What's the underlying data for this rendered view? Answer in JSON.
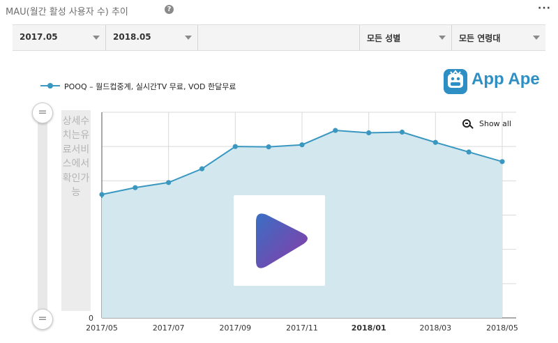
{
  "header": {
    "title": "MAU(월간 활성 사용자 수) 추이",
    "help_icon": "question-circle-icon",
    "more_icon": "more-horizontal-icon"
  },
  "filters": [
    {
      "label": "2017.05"
    },
    {
      "label": "2018.05"
    },
    {
      "label": "모든 성별"
    },
    {
      "label": "모든 연령대"
    }
  ],
  "legend": {
    "label": "POOQ – 월드컵중계, 실시간TV 무료, VOD 한달무료"
  },
  "logo": {
    "text": "App Ape"
  },
  "paywall_text": "상세수치는유료서비스에서확인가능",
  "show_all_label": "Show all",
  "colors": {
    "line": "#3a97c0",
    "area": "#d3e7ee",
    "grid": "#d9d9d9",
    "play_gradient_start": "#3a6fc4",
    "play_gradient_end": "#8a3aa6"
  },
  "chart_data": {
    "type": "area",
    "x": [
      "2017/05",
      "2017/06",
      "2017/07",
      "2017/08",
      "2017/09",
      "2017/10",
      "2017/11",
      "2017/12",
      "2018/01",
      "2018/02",
      "2018/03",
      "2018/04",
      "2018/05"
    ],
    "x_tick_labels": [
      "2017/05",
      "2017/07",
      "2017/09",
      "2017/11",
      "2018/01",
      "2018/03",
      "2018/05"
    ],
    "bold_tick_labels": [
      "2018/01"
    ],
    "y_tick_labels": [
      "0"
    ],
    "series": [
      {
        "name": "POOQ – 월드컵중계, 실시간TV 무료, VOD 한달무료",
        "values": [
          3.6,
          3.8,
          3.95,
          4.35,
          5.0,
          4.99,
          5.05,
          5.47,
          5.4,
          5.42,
          5.12,
          4.84,
          4.56
        ]
      }
    ],
    "ylim": [
      0,
      6
    ],
    "grid": true,
    "legend_position": "top-left"
  }
}
